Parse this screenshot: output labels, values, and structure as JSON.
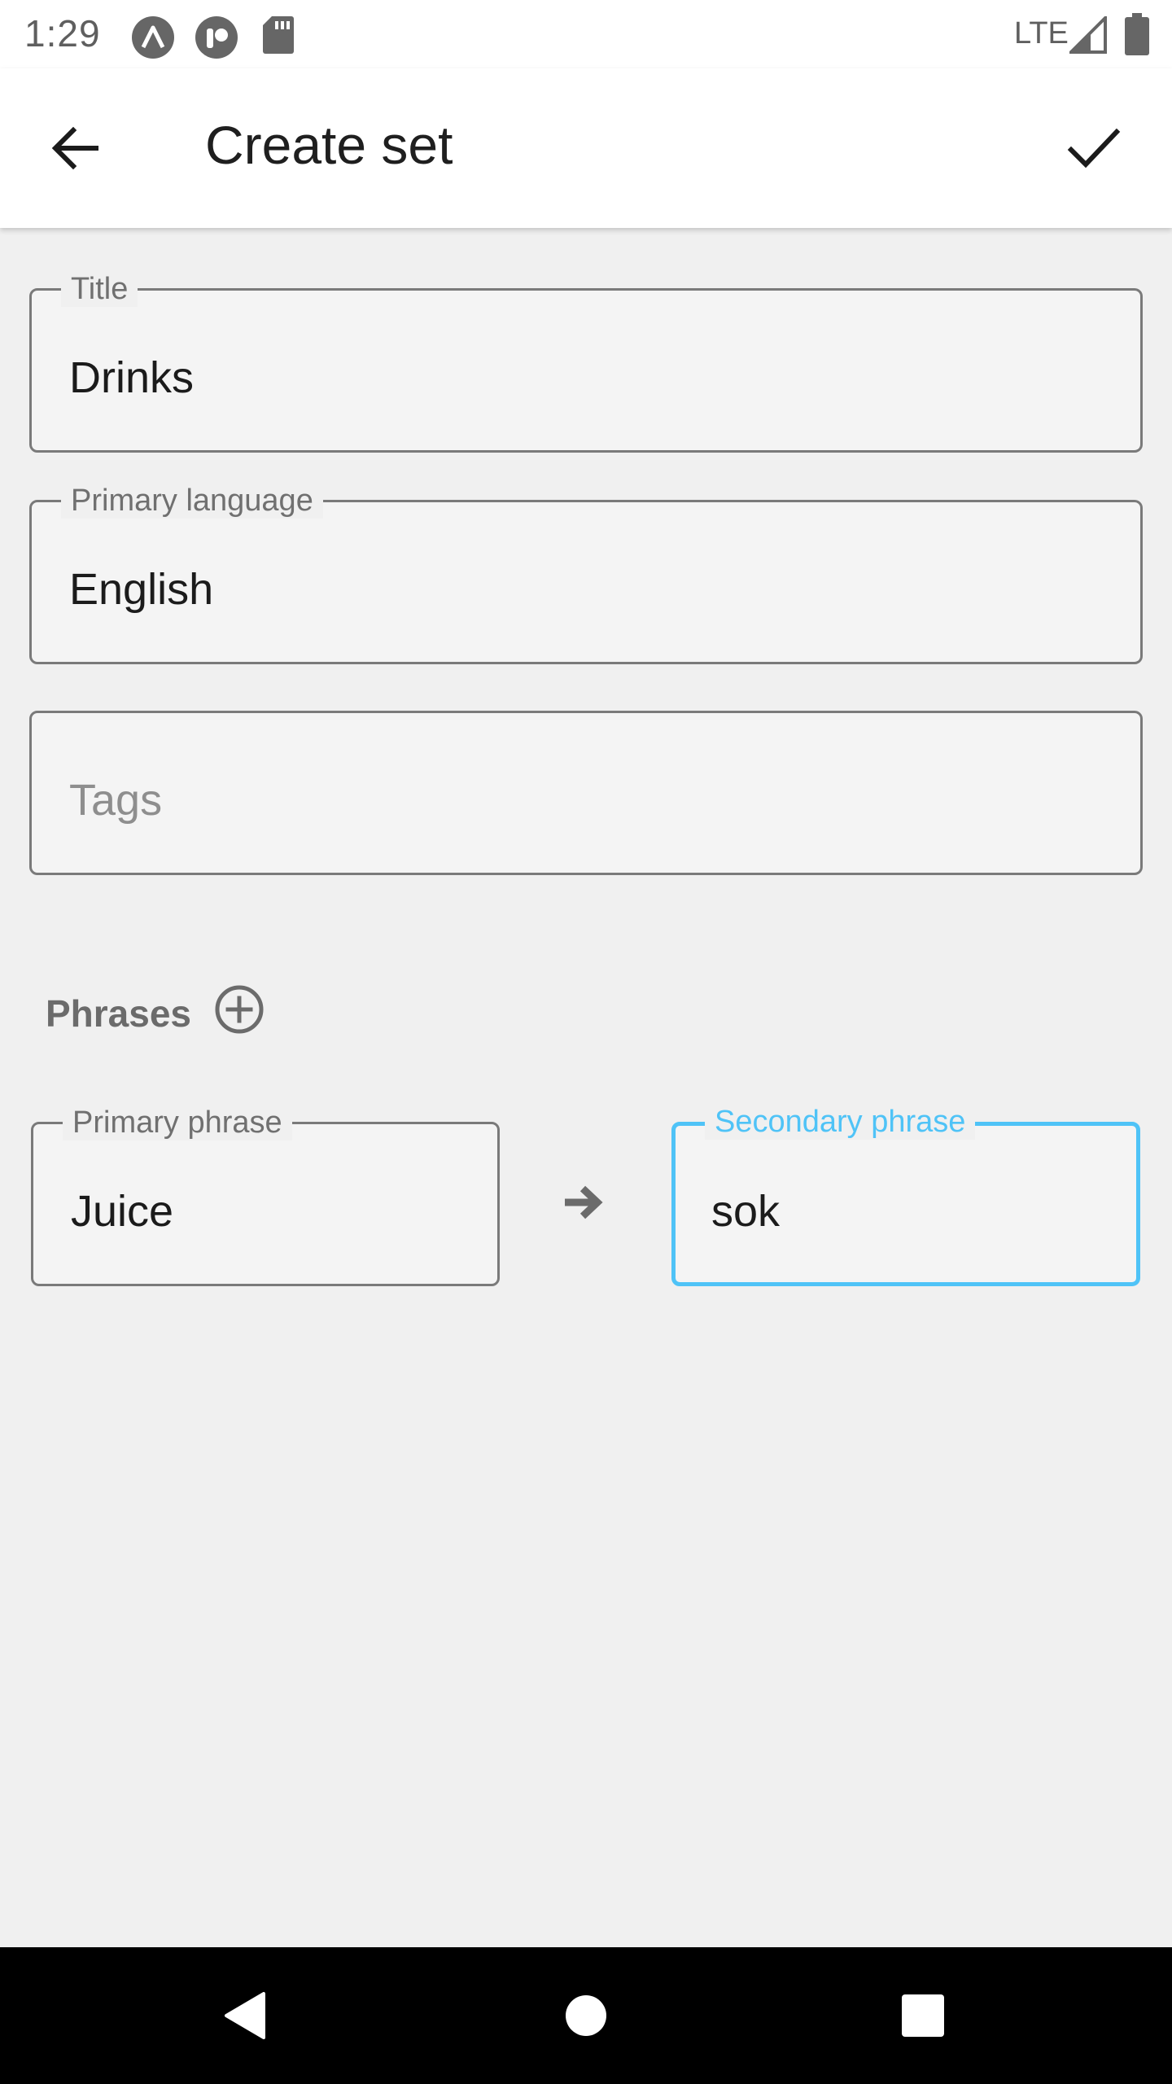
{
  "status_bar": {
    "time": "1:29",
    "network": "LTE",
    "icons": [
      "assistant-icon",
      "notification-app-icon",
      "sd-card-icon",
      "signal-icon",
      "battery-icon"
    ]
  },
  "app_bar": {
    "title": "Create set",
    "back_icon": "arrow-back-icon",
    "confirm_icon": "check-icon"
  },
  "form": {
    "title_field": {
      "label": "Title",
      "value": "Drinks"
    },
    "language_field": {
      "label": "Primary language",
      "value": "English"
    },
    "tags_field": {
      "placeholder": "Tags",
      "value": ""
    }
  },
  "phrases": {
    "label": "Phrases",
    "add_icon": "add-circle-outline-icon",
    "rows": [
      {
        "primary": {
          "label": "Primary phrase",
          "value": "Juice"
        },
        "arrow_icon": "arrow-right-icon",
        "secondary": {
          "label": "Secondary phrase",
          "value": "sok",
          "focused": true
        }
      }
    ]
  },
  "colors": {
    "accent": "#4fc3f7",
    "outline": "#7a7a7a",
    "background": "#f0f0f0",
    "text": "#1b1b1b"
  },
  "nav_bar": {
    "buttons": [
      "back-triangle-icon",
      "home-circle-icon",
      "recents-square-icon"
    ]
  }
}
